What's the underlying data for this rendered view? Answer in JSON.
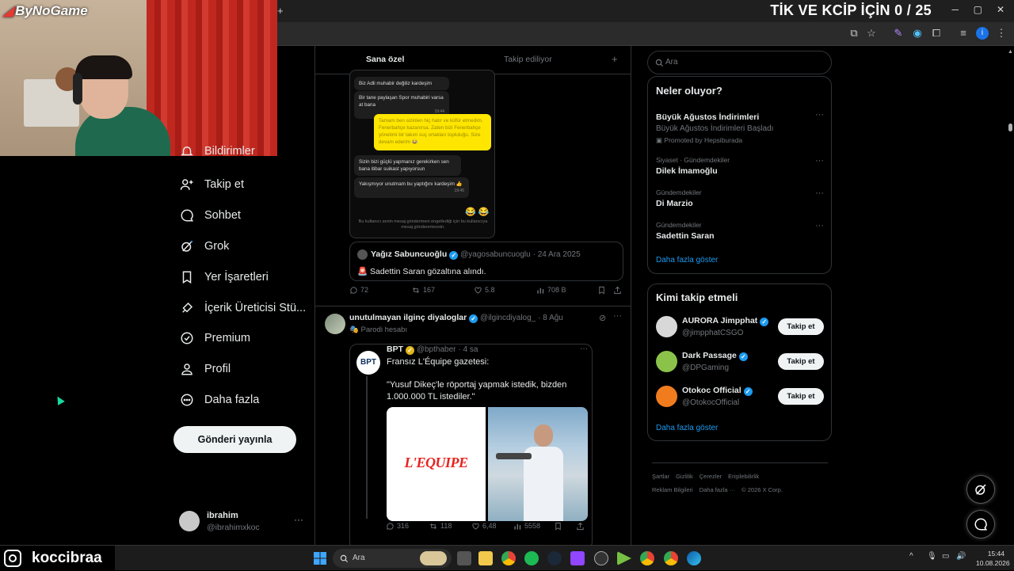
{
  "stream": {
    "title": "TİK VE KCİP İÇİN 0 / 25",
    "channel_logo": "ByNoGame",
    "username": "koccibraa"
  },
  "browser": {
    "new_tab_icon": "plus-icon",
    "window_controls": [
      "minimize",
      "restore",
      "close"
    ]
  },
  "nav": {
    "items": [
      {
        "label": "Bildirimler",
        "icon": "bell-icon"
      },
      {
        "label": "Takip et",
        "icon": "follow-icon"
      },
      {
        "label": "Sohbet",
        "icon": "chat-icon"
      },
      {
        "label": "Grok",
        "icon": "grok-icon"
      },
      {
        "label": "Yer İşaretleri",
        "icon": "bookmark-icon"
      },
      {
        "label": "İçerik Üreticisi Stü...",
        "icon": "rocket-icon"
      },
      {
        "label": "Premium",
        "icon": "premium-icon"
      },
      {
        "label": "Profil",
        "icon": "profile-icon"
      },
      {
        "label": "Daha fazla",
        "icon": "more-circle-icon"
      }
    ],
    "post_button": "Gönderi yayınla",
    "account": {
      "name": "ibrahim",
      "handle": "@ibrahimxkoc",
      "more": "···"
    }
  },
  "feed": {
    "tabs": [
      "Sana özel",
      "Takip ediliyor"
    ],
    "tab_add": "+",
    "chat_screenshot": {
      "messages": [
        {
          "text": "Biz Adli muhabir değiliz kardeşim",
          "time": ""
        },
        {
          "text": "Bir tane paylaşan Spor muhabiri varsa at bana",
          "time": "19:44"
        },
        {
          "text": "Tamam ben sizinlen hiç hatır ve küfür etmedim. Fenerbahçe kazanırsa. Zaten bizi Fenerbahçe yönetimi bir takım suç ortakları topluluğu. Size devam ederim 😂",
          "time": "19:44"
        },
        {
          "text": "Sizin bizi güçlü yapmanız gerekirken sen bana itibar suikast yapıyorsun",
          "time": ""
        },
        {
          "text": "Yakışmıyor unutmam bu yaptığını kardeşim 👍",
          "time": "19:45"
        }
      ],
      "emoji": "😂 😂",
      "footer": "Bu kullanıcı senin mesaj göndermeni engellediği için bu kullanıcıya mesaj gönderemezsin."
    },
    "quote1": {
      "name": "Yağız Sabuncuoğlu",
      "handle": "@yagosabuncuoglu",
      "date": "· 24 Ara 2025",
      "text": "🚨 Sadettin Saran gözaltına alındı."
    },
    "tweet1_stats": {
      "replies": "72",
      "reposts": "167",
      "likes": "5.8",
      "views": "708 B"
    },
    "tweet2": {
      "name": "unutulmayan ilginç diyaloglar",
      "handle": "@ilgincdiyalog_",
      "date": "· 8 Ağu",
      "label": "Parodi hesabı"
    },
    "quote2": {
      "name": "BPT",
      "handle": "@bpthaber",
      "date": "· 4 sa",
      "line1": "Fransız L'Équipe gazetesi:",
      "line2": "\"Yusuf Dikeç'le röportaj yapmak istedik, bizden 1.000.000 TL istediler.\"",
      "media_brand": "L'EQUIPE"
    },
    "tweet2_stats": {
      "replies": "316",
      "reposts": "118",
      "likes": "6,48",
      "views": "5558"
    }
  },
  "sidebar": {
    "search_placeholder": "Ara",
    "trends_title": "Neler oluyor?",
    "trends": [
      {
        "category": "",
        "name": "Büyük Ağustos İndirimleri",
        "sub": "Büyük Ağustos İndirimleri Başladı",
        "promo": "Promoted by Hepsiburada"
      },
      {
        "category": "Siyaset · Gündemdekiler",
        "name": "Dilek İmamoğlu"
      },
      {
        "category": "Gündemdekiler",
        "name": "Di Marzio"
      },
      {
        "category": "Gündemdekiler",
        "name": "Sadettin Saran"
      }
    ],
    "show_more": "Daha fazla göster",
    "follow_title": "Kimi takip etmeli",
    "follow": [
      {
        "name": "AURORA Jimpphat",
        "handle": "@jimpphatCSGO",
        "button": "Takip et",
        "avatar_color": "#d8d8d8"
      },
      {
        "name": "Dark Passage",
        "handle": "@DPGaming",
        "button": "Takip et",
        "avatar_color": "#8bc34a"
      },
      {
        "name": "Otokoc Official",
        "handle": "@OtokocOfficial",
        "button": "Takip et",
        "avatar_color": "#f07c1e"
      }
    ],
    "follow_more": "Daha fazla göster",
    "footer_row1": [
      "Şartlar",
      "Gizlilik",
      "Çerezler",
      "Erişilebilirlik"
    ],
    "footer_row2": [
      "Reklam Bilgileri",
      "Daha fazla ···",
      "© 2026 X Corp."
    ]
  },
  "taskbar": {
    "search_placeholder": "Ara",
    "time": "15:44",
    "date": "10.08.2026"
  },
  "colors": {
    "accent": "#1d9bf0",
    "background": "#000000",
    "border": "#2f3336",
    "muted": "#71767b"
  }
}
